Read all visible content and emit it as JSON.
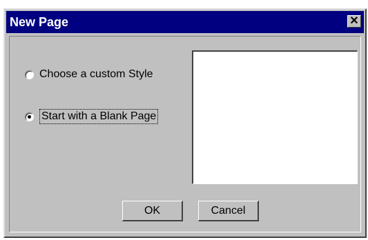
{
  "window": {
    "title": "New Page",
    "close_glyph": "✕"
  },
  "options": [
    {
      "label": "Choose a custom Style",
      "checked": false
    },
    {
      "label": "Start with a Blank Page",
      "checked": true
    }
  ],
  "buttons": {
    "ok_label": "OK",
    "cancel_label": "Cancel"
  },
  "colors": {
    "titlebar": "#000080",
    "dialog_face": "#c0c0c0"
  }
}
